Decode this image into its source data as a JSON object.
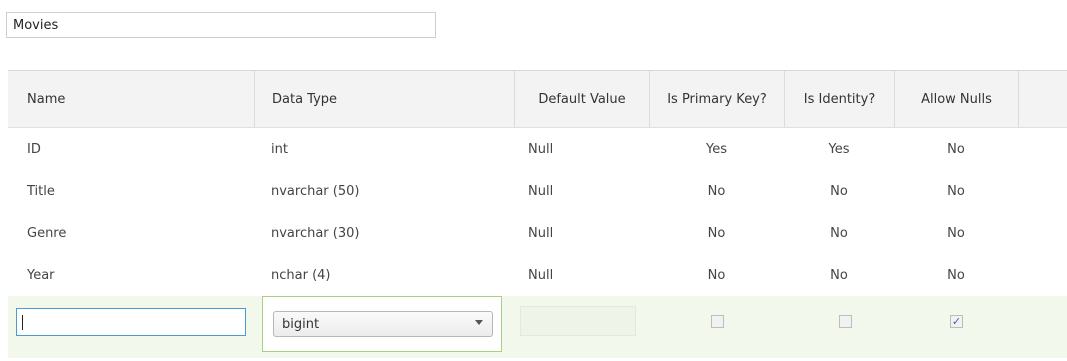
{
  "table_name": {
    "value": "Movies"
  },
  "grid": {
    "headers": [
      "Name",
      "Data Type",
      "Default Value",
      "Is Primary Key?",
      "Is Identity?",
      "Allow Nulls"
    ],
    "rows": [
      [
        "ID",
        "int",
        "Null",
        "Yes",
        "Yes",
        "No"
      ],
      [
        "Title",
        "nvarchar (50)",
        "Null",
        "No",
        "No",
        "No"
      ],
      [
        "Genre",
        "nvarchar (30)",
        "Null",
        "No",
        "No",
        "No"
      ],
      [
        "Year",
        "nchar (4)",
        "Null",
        "No",
        "No",
        "No"
      ]
    ],
    "new_row": {
      "name_value": "",
      "data_type_selected": "bigint",
      "default_value": "",
      "is_primary_key_checked": false,
      "is_identity_checked": false,
      "allow_nulls_checked": true,
      "check_glyph": "✓"
    }
  }
}
